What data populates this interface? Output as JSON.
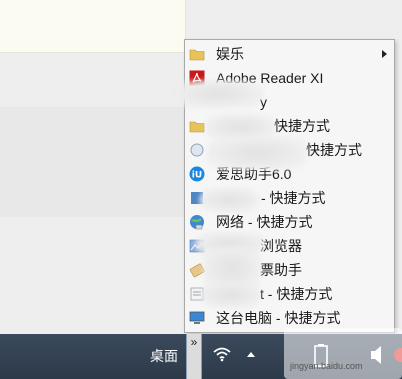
{
  "menu": {
    "items": [
      {
        "label": "娱乐",
        "icon": "folder-icon",
        "has_submenu": true
      },
      {
        "label": "Adobe Reader XI",
        "icon": "adobe-reader-icon"
      },
      {
        "label": "y",
        "icon": "app-icon"
      },
      {
        "label": "快捷方式",
        "icon": "folder-icon"
      },
      {
        "label": "快捷方式",
        "icon": "app-icon"
      },
      {
        "label": "爱思助手6.0",
        "icon": "i4-icon"
      },
      {
        "label": "- 快捷方式",
        "icon": "app-icon"
      },
      {
        "label": "网络 - 快捷方式",
        "icon": "network-icon"
      },
      {
        "label": "浏览器",
        "icon": "browser-icon"
      },
      {
        "label": "票助手",
        "icon": "ticket-icon"
      },
      {
        "label": "t - 快捷方式",
        "icon": "app-icon"
      },
      {
        "label": "这台电脑 - 快捷方式",
        "icon": "computer-icon"
      }
    ]
  },
  "taskbar": {
    "toolbar_label": "桌面",
    "chevron": "»",
    "tray": [
      "wifi-icon",
      "up-arrow-icon",
      "battery-icon",
      "volume-icon"
    ]
  },
  "watermark": {
    "text": "jingyan.baidu.com"
  }
}
